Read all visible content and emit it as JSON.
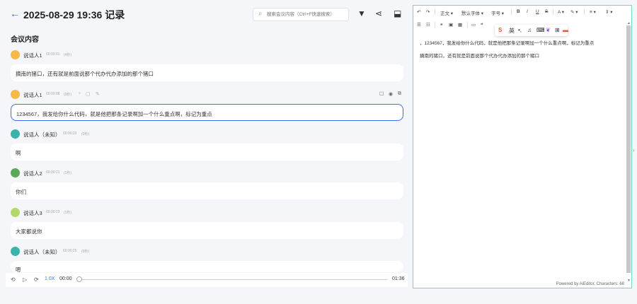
{
  "header": {
    "back": "←",
    "title": "2025-08-29 19:36 记录",
    "search_placeholder": "搜索会议内容（Ctrl+F快速搜索）"
  },
  "section_title": "会议内容",
  "entries": [
    {
      "speaker": "说话人1",
      "time": "00:00:01",
      "duration": "(4秒)",
      "text": "摘南的猪口，还有就是前面说那个代办代办添加的那个猪口",
      "avatar_color": "#f5b94a"
    },
    {
      "speaker": "说话人1",
      "time": "00:00:08",
      "duration": "(9秒)",
      "text": "1234567，我发给你什么代码，就是他把那条记录啊加一个什么重点啊，标记为重点",
      "avatar_color": "#f5b94a"
    },
    {
      "speaker": "说话人（未知）",
      "time": "00:00:20",
      "duration": "(0秒)",
      "text": "啊",
      "avatar_color": "#3bb3a8"
    },
    {
      "speaker": "说话人2",
      "time": "00:00:21",
      "duration": "(1秒)",
      "text": "你们",
      "avatar_color": "#5aa85a"
    },
    {
      "speaker": "说话人3",
      "time": "00:00:23",
      "duration": "(1秒)",
      "text": "大家都说你",
      "avatar_color": "#b5d86a"
    },
    {
      "speaker": "说话人（未知）",
      "time": "00:00:25",
      "duration": "(0秒)",
      "text": "嗯",
      "avatar_color": "#3bb3a8"
    }
  ],
  "player": {
    "speed": "1.0X",
    "current_time": "00:00",
    "total_time": "01:36",
    "progress": 0
  },
  "editor": {
    "toolbar": {
      "undo": "↶",
      "redo": "↷",
      "paragraph": "正文",
      "font": "默认字体",
      "size": "字号",
      "bold": "B",
      "italic": "I",
      "underline": "U",
      "strike": "S",
      "font_color": "A",
      "highlight": "✎",
      "align": "≡",
      "line_height": "⇕"
    },
    "ime_label": "英",
    "lines": [
      "，1234567，我发给你什么代码，就是他把那条记录啊加一个什么重点啊，标记为重点",
      "摘南的猪口，还有就是前面说那个代办代办添加的那个猪口"
    ],
    "footer": "Powered by AiEditor, Characters: 68"
  },
  "colors": {
    "accent": "#3a6cf4",
    "editor_border": "#79d4bf"
  }
}
